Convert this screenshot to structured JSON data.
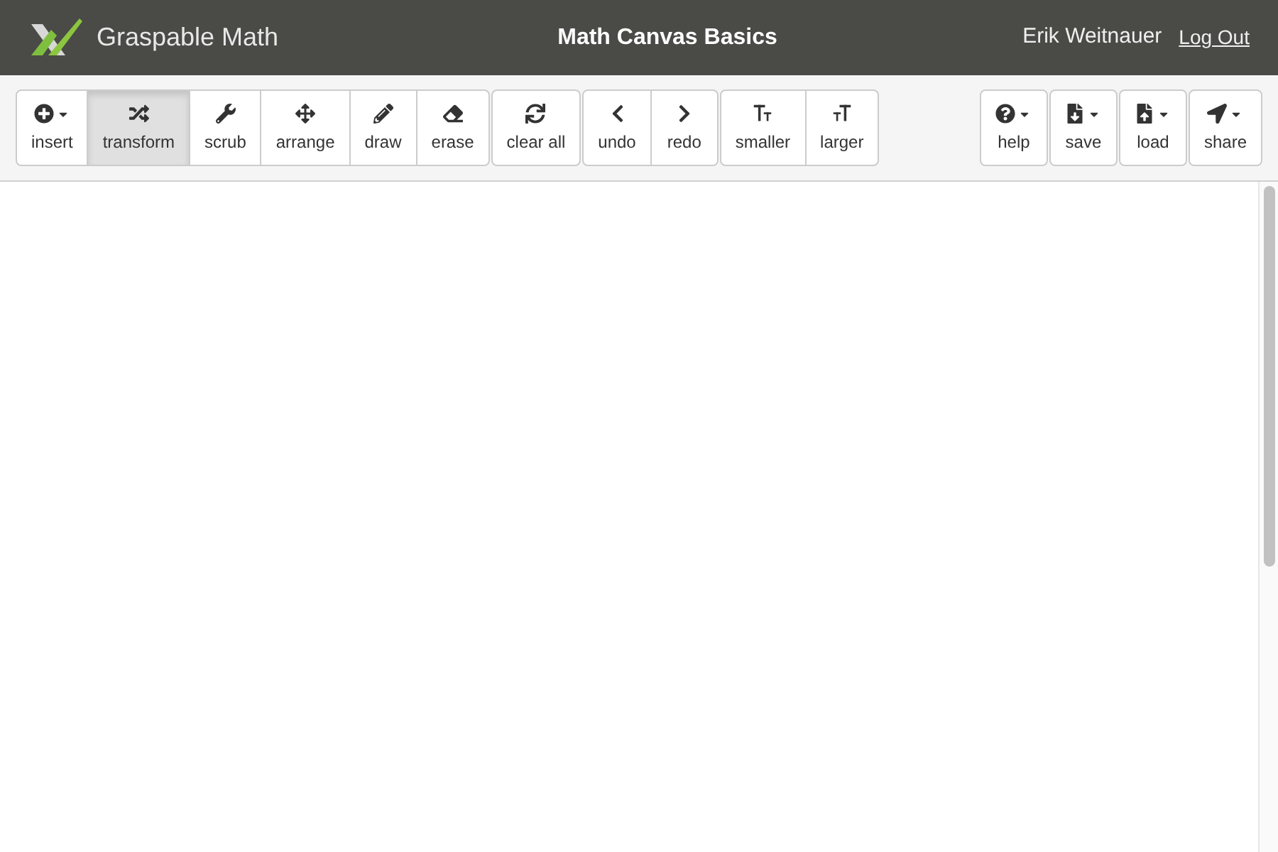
{
  "header": {
    "app_name": "Graspable Math",
    "title": "Math Canvas Basics",
    "user": "Erik Weitnauer",
    "logout": "Log Out"
  },
  "toolbar": {
    "left_groups": [
      [
        {
          "label": "insert",
          "dropdown": true,
          "selected": false
        },
        {
          "label": "transform",
          "dropdown": false,
          "selected": true
        },
        {
          "label": "scrub",
          "dropdown": false,
          "selected": false
        },
        {
          "label": "arrange",
          "dropdown": false,
          "selected": false
        },
        {
          "label": "draw",
          "dropdown": false,
          "selected": false
        },
        {
          "label": "erase",
          "dropdown": false,
          "selected": false
        }
      ],
      [
        {
          "label": "clear all",
          "dropdown": false,
          "selected": false
        }
      ],
      [
        {
          "label": "undo",
          "dropdown": false,
          "selected": false
        },
        {
          "label": "redo",
          "dropdown": false,
          "selected": false
        }
      ],
      [
        {
          "label": "smaller",
          "dropdown": false,
          "selected": false
        },
        {
          "label": "larger",
          "dropdown": false,
          "selected": false
        }
      ]
    ],
    "right_buttons": [
      {
        "label": "help",
        "dropdown": true,
        "selected": false
      },
      {
        "label": "save",
        "dropdown": true,
        "selected": false
      },
      {
        "label": "load",
        "dropdown": true,
        "selected": false
      },
      {
        "label": "share",
        "dropdown": true,
        "selected": false
      }
    ]
  }
}
